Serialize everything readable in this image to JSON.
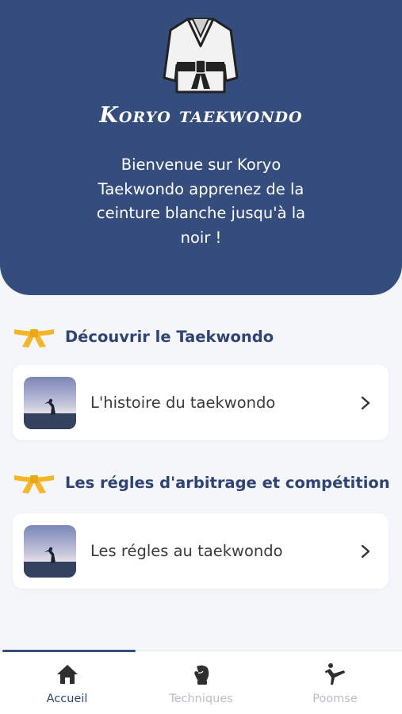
{
  "header": {
    "app_title": "Koryo taekwondo",
    "welcome_text": "Bienvenue sur Koryo Taekwondo apprenez de la ceinture blanche jusqu'à la noir !",
    "logo_icon": "karate-gi-icon"
  },
  "sections": [
    {
      "title": "Découvrir le Taekwondo",
      "icon": "yellow-belt-icon",
      "items": [
        {
          "label": "L'histoire du taekwondo",
          "thumb_icon": "taekwondo-sunset-image"
        }
      ]
    },
    {
      "title": "Les régles d'arbitrage et compétition",
      "icon": "yellow-belt-icon",
      "items": [
        {
          "label": "Les régles au taekwondo",
          "thumb_icon": "taekwondo-sunset-image"
        }
      ]
    }
  ],
  "tabbar": {
    "active_index": 0,
    "tabs": [
      {
        "label": "Accueil",
        "icon": "home-icon"
      },
      {
        "label": "Techniques",
        "icon": "boxing-glove-icon"
      },
      {
        "label": "Poomse",
        "icon": "kick-icon"
      }
    ]
  },
  "colors": {
    "primary": "#354d7c",
    "belt": "#f4b528",
    "background": "#f5f6fa",
    "inactive": "#b9bdc6"
  }
}
